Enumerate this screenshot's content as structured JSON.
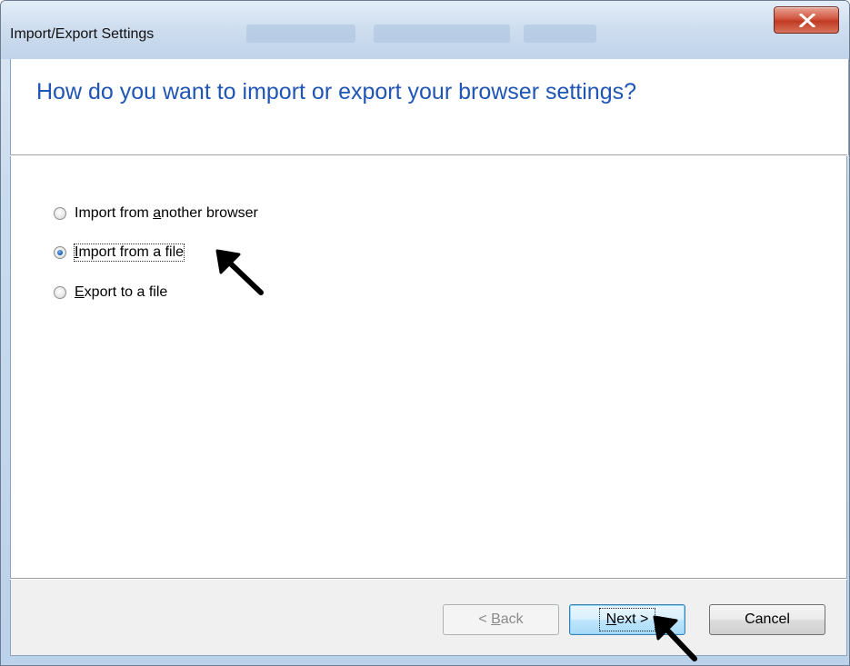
{
  "window": {
    "title": "Import/Export Settings",
    "close_glyph": "✕"
  },
  "header": {
    "title": "How do you want to import or export your browser settings?"
  },
  "options": [
    {
      "pre": "Import from ",
      "mnemonic": "a",
      "post": "nother browser",
      "checked": false
    },
    {
      "pre": "",
      "mnemonic": "I",
      "post": "mport from a file",
      "checked": true
    },
    {
      "pre": "",
      "mnemonic": "E",
      "post": "xport to a file",
      "checked": false
    }
  ],
  "buttons": {
    "back": {
      "pre": "< ",
      "mnemonic": "B",
      "post": "ack",
      "enabled": false
    },
    "next": {
      "pre": "",
      "mnemonic": "N",
      "post": "ext >",
      "enabled": true
    },
    "cancel": {
      "label": "Cancel"
    }
  },
  "annotations": {
    "arrow_color": "#000000"
  },
  "colors": {
    "header_text": "#1f55b5",
    "close_button": "#c03a22",
    "default_button_border": "#3c7fb1"
  }
}
